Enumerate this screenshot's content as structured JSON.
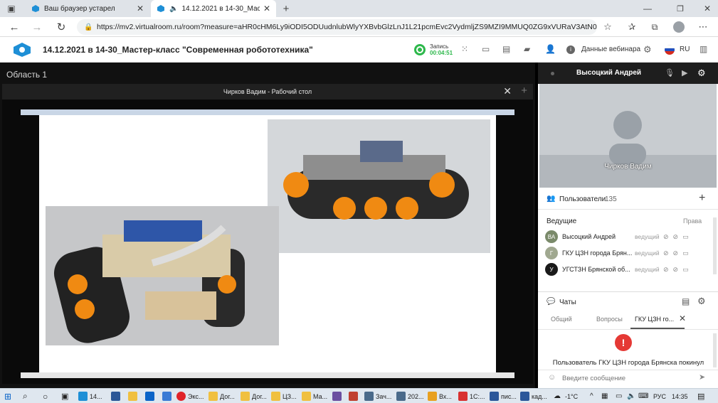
{
  "browser": {
    "tabs": [
      {
        "label": "Ваш браузер устарел",
        "active": false
      },
      {
        "label": "14.12.2021 в 14-30_Мастер",
        "active": true
      }
    ],
    "new_tab": "+",
    "url": "https://mv2.virtualroom.ru/room?measure=aHR0cHM6Ly9iODI5ODUudnlubWlyYXBvbGlzLnJ1L21pcmEvc2VydmljZS9MZI9MMUQ0ZG9xVURaV3AtN0dl..."
  },
  "app": {
    "title": "14.12.2021 в 14-30_Мастер-класс \"Современная робототехника\"",
    "record_label": "Запись",
    "record_time": "00:04:51",
    "webinar_data": "Данные вебинара",
    "language": "RU"
  },
  "main": {
    "area_label": "Область 1",
    "share_title": "Чирков Вадим - Рабочий стол",
    "close": "✕",
    "add": "+"
  },
  "video": {
    "presenter": "Высоцкий Андрей",
    "caption": "Чирков Вадим"
  },
  "users": {
    "title": "Пользователи",
    "count": "135",
    "add": "+",
    "section": "Ведущие",
    "rights": "Права",
    "list": [
      {
        "initials": "ВА",
        "name": "Высоцкий Андрей",
        "role": "ведущий",
        "color": "#7a8a6a"
      },
      {
        "initials": "Г",
        "name": "ГКУ ЦЗН города Брян...",
        "role": "ведущий",
        "color": "#a0a890"
      },
      {
        "initials": "У",
        "name": "УГСТЗН Брянской об...",
        "role": "ведущий",
        "color": "#1a1a1a"
      }
    ]
  },
  "chats": {
    "title": "Чаты",
    "tabs": [
      "Общий",
      "Вопросы",
      "ГКУ ЦЗН го..."
    ],
    "close": "✕",
    "alert": "!",
    "message": "Пользователь ГКУ ЦЗН города Брянска покинул",
    "placeholder": "Введите сообщение"
  },
  "taskbar": {
    "items": [
      "14...",
      "Экс...",
      "Дог...",
      "Дог...",
      "ЦЗ...",
      "Ма...",
      "Зач...",
      "202...",
      "Вх...",
      "1С:...",
      "пис...",
      "кад..."
    ],
    "weather": "-1°C",
    "lang": "РУС",
    "time": "14:35"
  }
}
